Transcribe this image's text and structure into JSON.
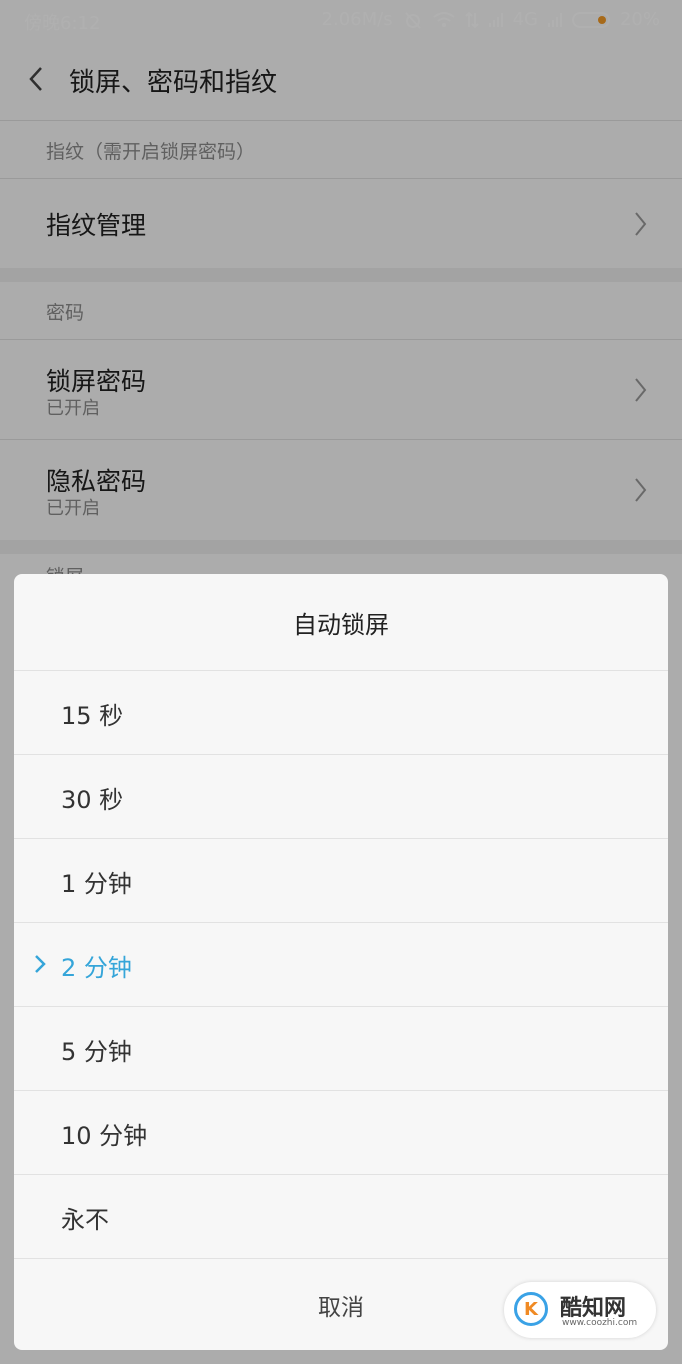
{
  "status_bar": {
    "time": "傍晚6:12",
    "speed": "2.06M/s",
    "network": "4G",
    "battery": "20%",
    "battery_color": "#f29a26"
  },
  "header": {
    "title": "锁屏、密码和指纹",
    "back_icon": "chevron-left-icon"
  },
  "fingerprint_section": {
    "title": "指纹（需开启锁屏密码）",
    "items": [
      {
        "label": "指纹管理"
      }
    ]
  },
  "password_section": {
    "title": "密码",
    "items": [
      {
        "label": "锁屏密码",
        "sub": "已开启"
      },
      {
        "label": "隐私密码",
        "sub": "已开启"
      }
    ]
  },
  "next_section_title": "锁屏",
  "dialog": {
    "title": "自动锁屏",
    "selected_color": "#35a5d9",
    "options": [
      {
        "label": "15 秒",
        "selected": false
      },
      {
        "label": "30 秒",
        "selected": false
      },
      {
        "label": "1 分钟",
        "selected": false
      },
      {
        "label": "2 分钟",
        "selected": true
      },
      {
        "label": "5 分钟",
        "selected": false
      },
      {
        "label": "10 分钟",
        "selected": false
      },
      {
        "label": "永不",
        "selected": false
      }
    ],
    "cancel": "取消"
  },
  "watermark": {
    "name": "酷知网",
    "url": "www.coozhi.com"
  }
}
